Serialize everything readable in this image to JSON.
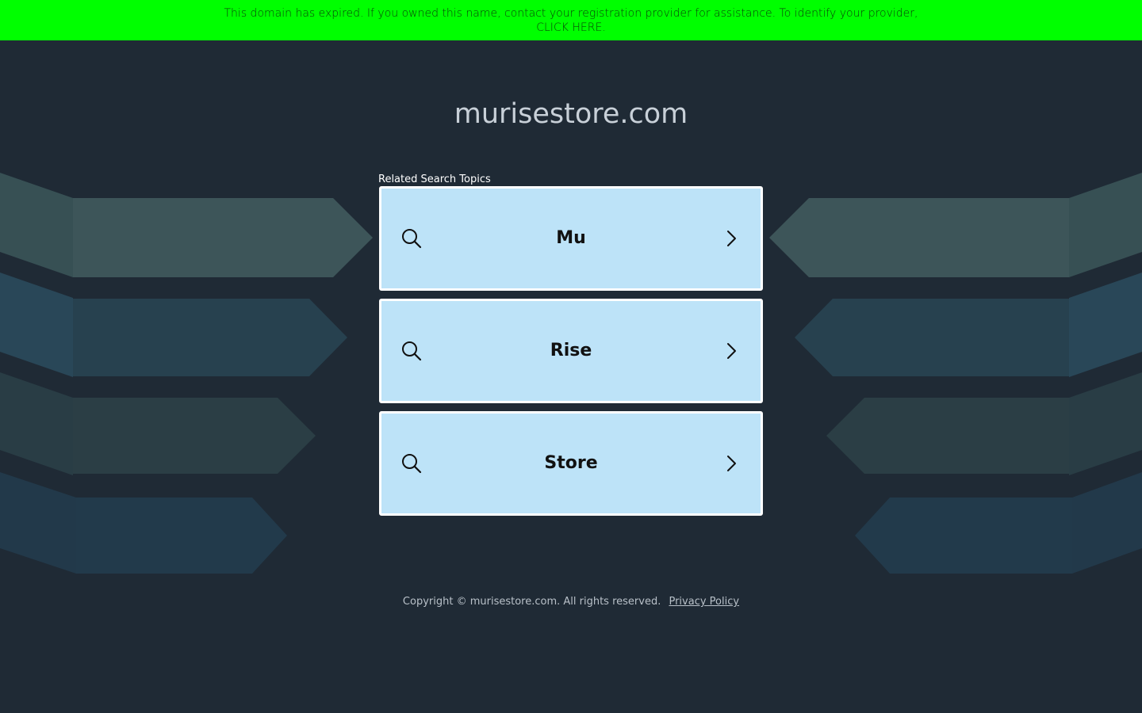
{
  "banner": {
    "message": "This domain has expired. If you owned this name, contact your registration provider for assistance. To identify your provider,",
    "cta": "CLICK HERE."
  },
  "domain": {
    "title": "murisestore.com"
  },
  "related": {
    "label": "Related Search Topics",
    "items": [
      {
        "label": "Mu",
        "icon": "search-icon",
        "action_icon": "chevron-right-icon"
      },
      {
        "label": "Rise",
        "icon": "search-icon",
        "action_icon": "chevron-right-icon"
      },
      {
        "label": "Store",
        "icon": "search-icon",
        "action_icon": "chevron-right-icon"
      }
    ]
  },
  "footer": {
    "copyright": "Copyright © murisestore.com.  All rights reserved.",
    "privacy_link": "Privacy Policy"
  },
  "colors": {
    "banner_bg": "#00ff00",
    "page_bg": "#1f2a35",
    "topic_bg": "#bde3f8",
    "topic_border": "#ffffff"
  }
}
